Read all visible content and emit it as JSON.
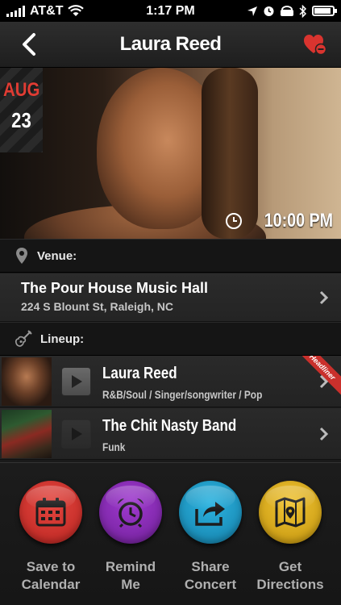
{
  "status_bar": {
    "carrier": "AT&T",
    "time": "1:17 PM"
  },
  "nav": {
    "title": "Laura Reed"
  },
  "hero": {
    "month": "AUG",
    "day": "23",
    "show_time": "10:00 PM"
  },
  "venue_section": {
    "label": "Venue:",
    "name": "The Pour House Music Hall",
    "address": "224 S Blount St, Raleigh, NC"
  },
  "lineup_section": {
    "label": "Lineup:",
    "artists": [
      {
        "name": "Laura Reed",
        "genre": "R&B/Soul / Singer/songwriter / Pop",
        "badge": "Headliner"
      },
      {
        "name": "The Chit Nasty Band",
        "genre": "Funk"
      }
    ]
  },
  "actions": [
    {
      "line1": "Save to",
      "line2": "Calendar",
      "color": "#d8322e",
      "icon": "calendar-icon"
    },
    {
      "line1": "Remind",
      "line2": "Me",
      "color": "#8a2bb8",
      "icon": "alarm-clock-icon"
    },
    {
      "line1": "Share",
      "line2": "Concert",
      "color": "#1f9ccc",
      "icon": "share-icon"
    },
    {
      "line1": "Get",
      "line2": "Directions",
      "color": "#e2b219",
      "icon": "map-icon"
    }
  ],
  "colors": {
    "accent_red": "#e03c33",
    "background": "#1b1b1b"
  }
}
